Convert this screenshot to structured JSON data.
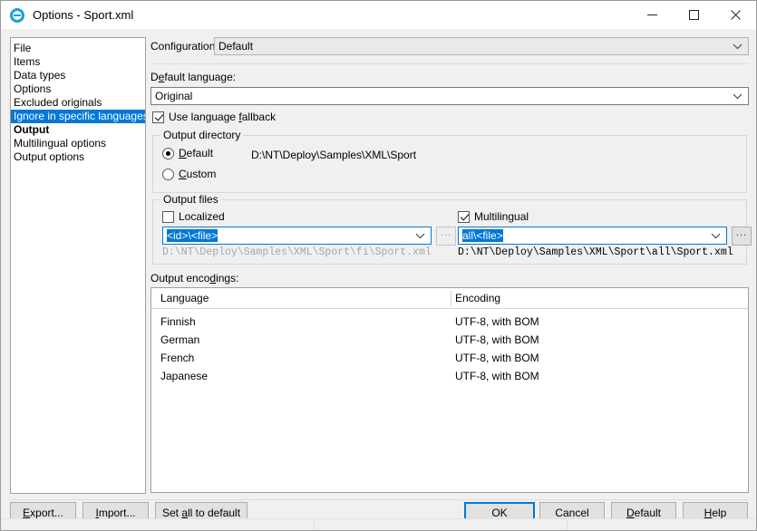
{
  "window": {
    "title": "Options - Sport.xml",
    "icon": "options-circle-icon",
    "minimize": "minimize-icon",
    "maximize": "maximize-icon",
    "close": "close-icon",
    "accent_color": "#0078d7"
  },
  "sidebar": {
    "items": [
      {
        "label": "File",
        "selected": false,
        "bold": false
      },
      {
        "label": "Items",
        "selected": false,
        "bold": false
      },
      {
        "label": "Data types",
        "selected": false,
        "bold": false
      },
      {
        "label": "Options",
        "selected": false,
        "bold": false
      },
      {
        "label": "Excluded originals",
        "selected": false,
        "bold": false
      },
      {
        "label": "Ignore in specific languages",
        "selected": true,
        "bold": false
      },
      {
        "label": "Output",
        "selected": false,
        "bold": true
      },
      {
        "label": "Multilingual options",
        "selected": false,
        "bold": false
      },
      {
        "label": "Output options",
        "selected": false,
        "bold": false
      }
    ]
  },
  "config": {
    "label": "Configuration:",
    "value": "Default"
  },
  "default_language": {
    "label_pre": "D",
    "label_acc": "e",
    "label_post": "fault language:",
    "value": "Original"
  },
  "fallback": {
    "label_pre": "Use language ",
    "label_acc": "f",
    "label_post": "allback",
    "checked": true
  },
  "output_directory": {
    "title": "Output directory",
    "default": {
      "label_acc": "D",
      "label_post": "efault",
      "selected": true,
      "path": "D:\\NT\\Deploy\\Samples\\XML\\Sport"
    },
    "custom": {
      "label_acc": "C",
      "label_post": "ustom",
      "selected": false
    }
  },
  "output_files": {
    "title": "Output files",
    "localized": {
      "label": "Localized",
      "checked": false,
      "pattern": "<id>\\<file>",
      "preview": "D:\\NT\\Deploy\\Samples\\XML\\Sport\\fi\\Sport.xml",
      "browse": "...",
      "enabled": false
    },
    "multilingual": {
      "label": "Multilingual",
      "checked": true,
      "pattern": "all\\<file>",
      "preview": "D:\\NT\\Deploy\\Samples\\XML\\Sport\\all\\Sport.xml",
      "browse": "...",
      "enabled": true
    }
  },
  "output_encodings": {
    "label_pre": "Output enco",
    "label_acc": "d",
    "label_post": "ings:",
    "columns": [
      "Language",
      "Encoding"
    ],
    "rows": [
      {
        "language": "Finnish",
        "encoding": "UTF-8, with BOM"
      },
      {
        "language": "German",
        "encoding": "UTF-8, with BOM"
      },
      {
        "language": "French",
        "encoding": "UTF-8, with BOM"
      },
      {
        "language": "Japanese",
        "encoding": "UTF-8, with BOM"
      }
    ]
  },
  "footer": {
    "export": {
      "acc": "E",
      "post": "xport..."
    },
    "import": {
      "acc": "I",
      "post": "mport..."
    },
    "set_all": {
      "pre": "Set ",
      "acc": "a",
      "post": "ll to default"
    },
    "ok": "OK",
    "cancel": "Cancel",
    "default": {
      "acc": "D",
      "post": "efault"
    },
    "help": {
      "acc": "H",
      "post": "elp"
    }
  }
}
